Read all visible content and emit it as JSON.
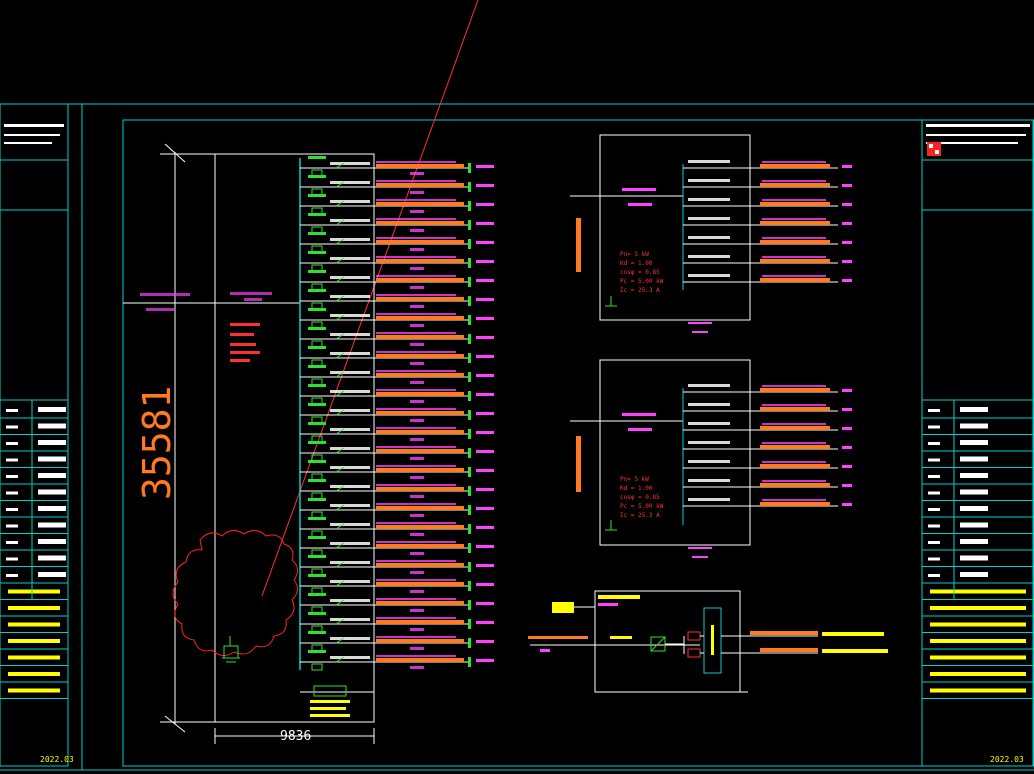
{
  "drawing": {
    "background": "#000000",
    "colors": {
      "frame": "#00d0d0",
      "panel": "#ffffff",
      "busbar": "#ff3030",
      "text_magenta": "#ff40ff",
      "text_red": "#ff3030",
      "cable": "#ff7a20",
      "load_green": "#30e030",
      "yellow": "#ffff00",
      "cloud": "#ff2020"
    },
    "dimension_vertical": "35581",
    "dimension_horizontal": "9836",
    "main_panel_params": [
      "Pn=",
      "Kd=",
      "cosφ=",
      "Pc=",
      "Ic="
    ],
    "sub_panel_1_params": [
      "Pn= 5 kW",
      "Kd = 1.00",
      "cosφ = 0.85",
      "Pc = 5.00 kW",
      "Ic = 25.3 A"
    ],
    "sub_panel_2_params": [
      "Pn= 5 kW",
      "Kd = 1.00",
      "cosφ = 0.85",
      "Pc = 5.00 kW",
      "Ic = 25.3 A"
    ],
    "title_block_right_date": "2022.03",
    "title_block_left_date": "2022.03"
  }
}
